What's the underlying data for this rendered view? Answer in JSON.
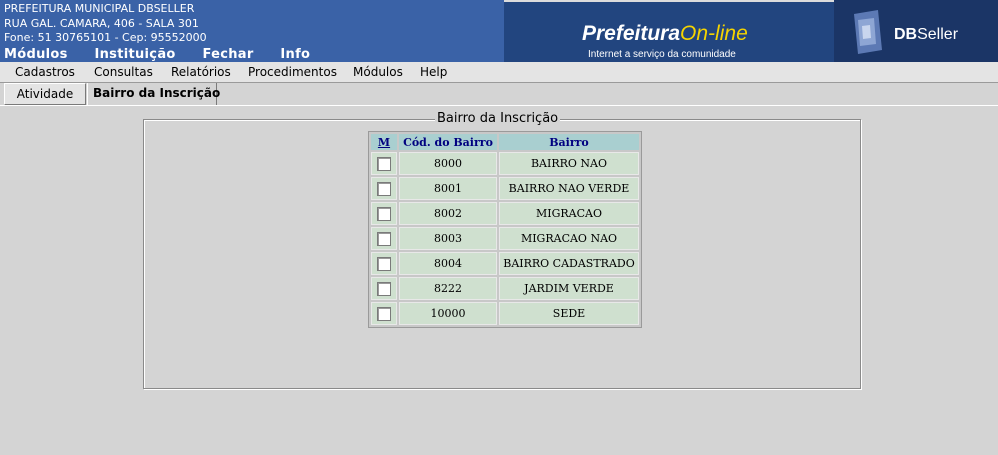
{
  "header": {
    "org_name": "PREFEITURA MUNICIPAL DBSELLER",
    "address": "RUA GAL. CAMARA, 406 - SALA 301",
    "phone_cep": "Fone: 51 30765101  -  Cep: 95552000",
    "menu": [
      "Módulos",
      "Instituição",
      "Fechar",
      "Info"
    ],
    "banner_brand_main": "Prefeitura",
    "banner_brand_accent": "On-line",
    "banner_tagline": "Internet a serviço da comunidade",
    "company_logo_bold": "DB",
    "company_logo_rest": "Seller"
  },
  "menubar": [
    "Cadastros",
    "Consultas",
    "Relatórios",
    "Procedimentos",
    "Módulos",
    "Help"
  ],
  "tabs": [
    {
      "label": "Atividade",
      "active": false
    },
    {
      "label": "Bairro da Inscrição",
      "active": true
    }
  ],
  "panel": {
    "legend": "Bairro da Inscrição",
    "columns": [
      "M",
      "Cód. do Bairro",
      "Bairro"
    ],
    "rows": [
      {
        "code": "8000",
        "name": "BAIRRO NAO",
        "checked": false
      },
      {
        "code": "8001",
        "name": "BAIRRO NAO VERDE",
        "checked": false
      },
      {
        "code": "8002",
        "name": "MIGRACAO",
        "checked": false
      },
      {
        "code": "8003",
        "name": "MIGRACAO NAO",
        "checked": false
      },
      {
        "code": "8004",
        "name": "BAIRRO CADASTRADO",
        "checked": false
      },
      {
        "code": "8222",
        "name": "JARDIM VERDE",
        "checked": false
      },
      {
        "code": "10000",
        "name": "SEDE",
        "checked": false
      }
    ]
  },
  "colors": {
    "header_bg": "#3a62a7",
    "banner_bg": "#22457f",
    "accent_yellow": "#f5d400",
    "table_header_bg": "#a9cfd0",
    "table_cell_bg": "#cfe0cf",
    "page_bg": "#d4d4d4"
  }
}
